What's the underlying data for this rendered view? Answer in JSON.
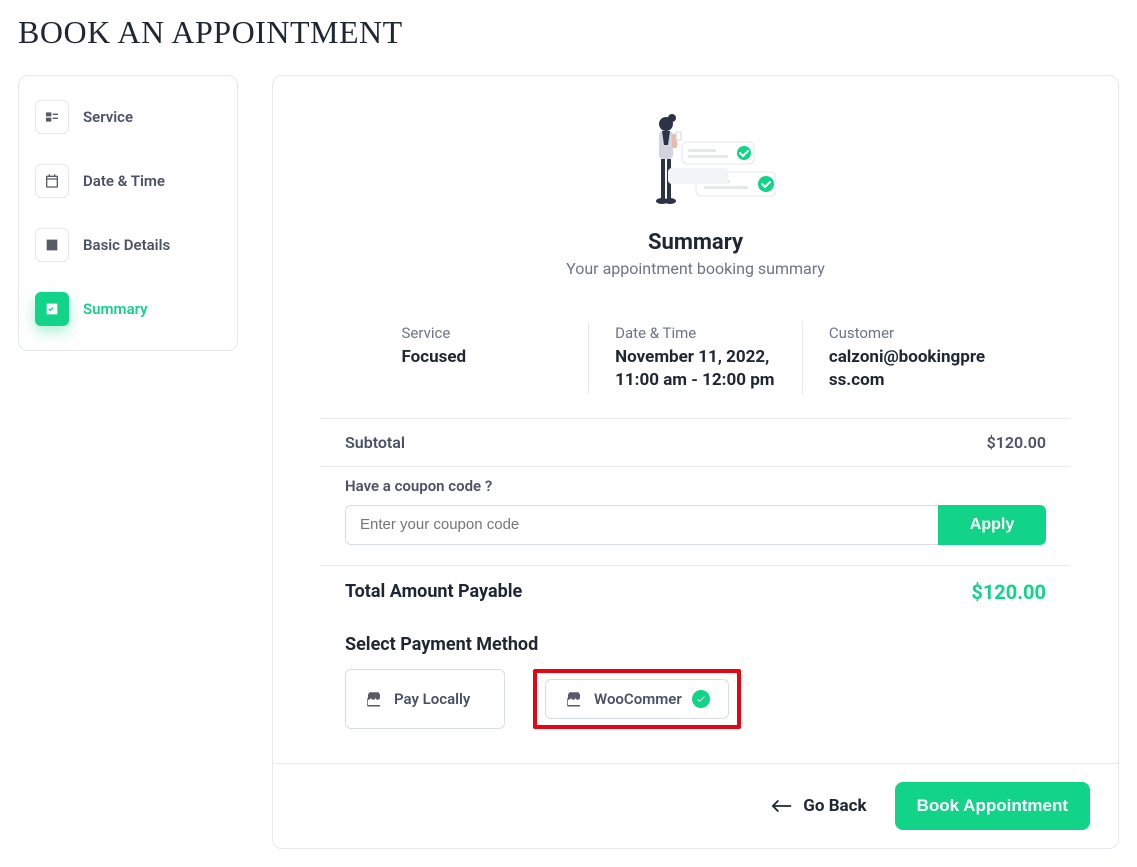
{
  "page_title": "BOOK AN APPOINTMENT",
  "sidebar": {
    "items": [
      {
        "label": "Service",
        "icon": "list-icon",
        "active": false
      },
      {
        "label": "Date & Time",
        "icon": "calendar-icon",
        "active": false
      },
      {
        "label": "Basic Details",
        "icon": "details-icon",
        "active": false
      },
      {
        "label": "Summary",
        "icon": "summary-icon",
        "active": true
      }
    ]
  },
  "summary": {
    "heading": "Summary",
    "subheading": "Your appointment booking summary",
    "details": {
      "service_label": "Service",
      "service_value": "Focused",
      "datetime_label": "Date & Time",
      "datetime_value": "November 11, 2022, 11:00 am - 12:00 pm",
      "customer_label": "Customer",
      "customer_value": "calzoni@bookingpress.com"
    },
    "subtotal_label": "Subtotal",
    "subtotal_value": "$120.00",
    "coupon_label": "Have a coupon code ?",
    "coupon_placeholder": "Enter your coupon code",
    "coupon_apply": "Apply",
    "total_label": "Total Amount Payable",
    "total_value": "$120.00",
    "payment_header": "Select Payment Method",
    "payment_options": [
      {
        "label": "Pay Locally",
        "selected": false
      },
      {
        "label": "WooCommer",
        "selected": true
      }
    ]
  },
  "footer": {
    "back": "Go Back",
    "book": "Book Appointment"
  },
  "colors": {
    "accent": "#12d488",
    "highlight": "#e30613"
  }
}
